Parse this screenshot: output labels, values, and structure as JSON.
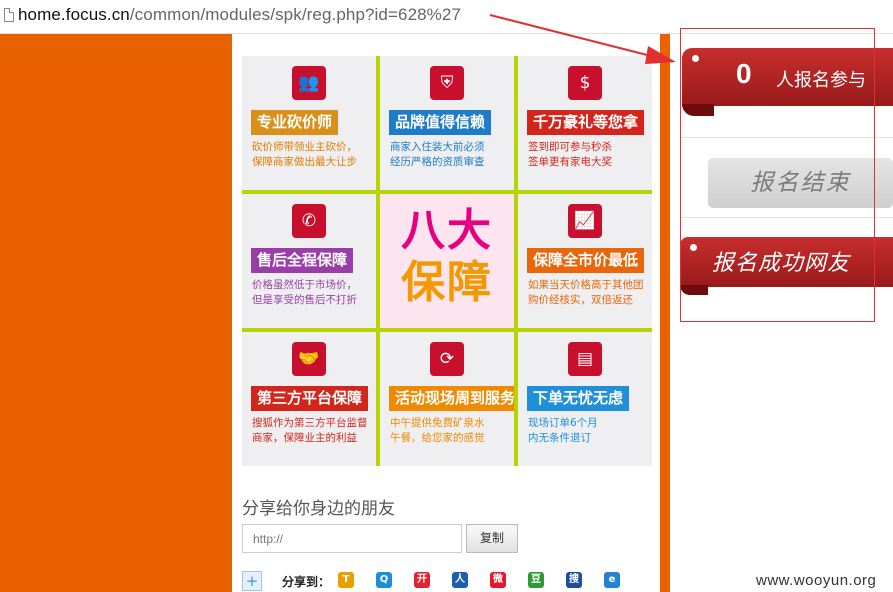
{
  "url": {
    "host": "home.focus.cn",
    "path": "/common/modules/spk/reg.php?id=628%27"
  },
  "colors": {
    "orange_band": "#ea6200",
    "grid_border": "#b7d300",
    "annotation_red": "#e03030"
  },
  "cells": [
    {
      "icon": "group-icon",
      "glyph": "👥",
      "title": "专业砍价师",
      "title_bg": "#d9901a",
      "desc": "砍价师带领业主砍价，\n保障商家做出最大让步",
      "desc_color": "#e07b00"
    },
    {
      "icon": "shield-icon",
      "glyph": "⛨",
      "title": "品牌值得信赖",
      "title_bg": "#1e7cc8",
      "desc": "商家入住装大前必须\n经历严格的资质审查",
      "desc_color": "#1e7cc8"
    },
    {
      "icon": "money-bag-icon",
      "glyph": "$",
      "title": "千万豪礼等您拿",
      "title_bg": "#d2261c",
      "desc": "签到即可参与秒杀\n签单更有家电大奖",
      "desc_color": "#d2261c"
    },
    {
      "icon": "phone-icon",
      "glyph": "✆",
      "title": "售后全程保障",
      "title_bg": "#9a3ea7",
      "desc": "价格虽然低于市场价，\n但是享受的售后不打折",
      "desc_color": "#9a3ea7"
    },
    {
      "center": true,
      "big_top": "八大",
      "big_bottom": "保障"
    },
    {
      "icon": "chart-icon",
      "glyph": "📈",
      "title": "保障全市价最低",
      "title_bg": "#e8660c",
      "desc": "如果当天价格高于其他团\n购价经核实，双倍返还",
      "desc_color": "#e8660c"
    },
    {
      "icon": "handshake-icon",
      "glyph": "🤝",
      "title": "第三方平台保障",
      "title_bg": "#d2261c",
      "desc": "搜狐作为第三方平台监督\n商家，保障业主的利益",
      "desc_color": "#d2261c"
    },
    {
      "icon": "refresh-icon",
      "glyph": "⟳",
      "title": "活动现场周到服务",
      "title_bg": "#ef8a00",
      "desc": "中午提供免费矿泉水\n午餐，给您家的感觉",
      "desc_color": "#ef8a00"
    },
    {
      "icon": "document-icon",
      "glyph": "▤",
      "title": "下单无忧无虑",
      "title_bg": "#1e8fd8",
      "desc": "现场订单6个月\n内无条件退订",
      "desc_color": "#1e8fd8"
    }
  ],
  "share": {
    "title": "分享给你身边的朋友",
    "placeholder": "http://",
    "copy_label": "复制",
    "plus": "+",
    "label": "分享到：",
    "icons": [
      {
        "name": "tencent-weibo-icon",
        "glyph": "T",
        "color": "#e8a000"
      },
      {
        "name": "qzone-icon",
        "glyph": "Q",
        "color": "#1d8fd8"
      },
      {
        "name": "kaixin-icon",
        "glyph": "开",
        "color": "#e3232c"
      },
      {
        "name": "renren-icon",
        "glyph": "人",
        "color": "#1c5fae"
      },
      {
        "name": "sina-weibo-icon",
        "glyph": "微",
        "color": "#e6162d"
      },
      {
        "name": "douban-icon",
        "glyph": "豆",
        "color": "#2f9a3a"
      },
      {
        "name": "sohu-icon",
        "glyph": "搜",
        "color": "#1f4c9b"
      },
      {
        "name": "bookmark-icon",
        "glyph": "e",
        "color": "#2583d4"
      }
    ]
  },
  "sidebar": {
    "count": "0",
    "count_label": "人报名参与",
    "end_button": "报名结束",
    "success_label": "报名成功网友"
  },
  "watermark": "www.wooyun.org"
}
